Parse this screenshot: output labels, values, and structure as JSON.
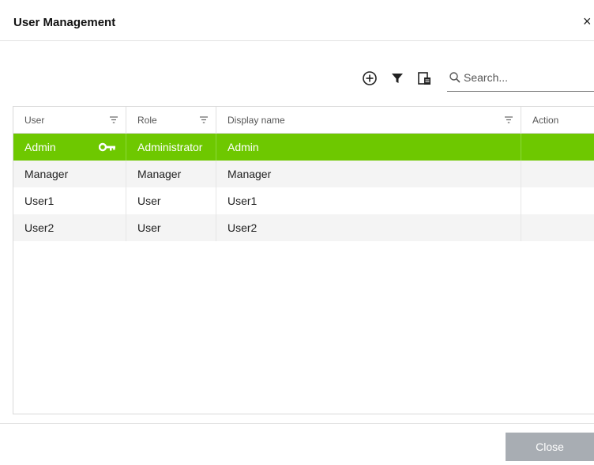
{
  "dialog": {
    "title": "User Management",
    "close_glyph": "×"
  },
  "toolbar": {
    "add_icon": "add-circle-icon",
    "filter_icon": "filter-icon",
    "columns_icon": "column-chooser-icon",
    "search_placeholder": "Search..."
  },
  "table": {
    "columns": [
      "User",
      "Role",
      "Display name",
      "Action"
    ],
    "rows": [
      {
        "user": "Admin",
        "role": "Administrator",
        "display_name": "Admin",
        "selected": true,
        "icon": "key-icon"
      },
      {
        "user": "Manager",
        "role": "Manager",
        "display_name": "Manager"
      },
      {
        "user": "User1",
        "role": "User",
        "display_name": "User1"
      },
      {
        "user": "User2",
        "role": "User",
        "display_name": "User2"
      }
    ]
  },
  "footer": {
    "close_label": "Close"
  },
  "colors": {
    "selected_row": "#6ec800",
    "alt_row": "#f4f4f4",
    "close_button": "#a8adb3"
  }
}
